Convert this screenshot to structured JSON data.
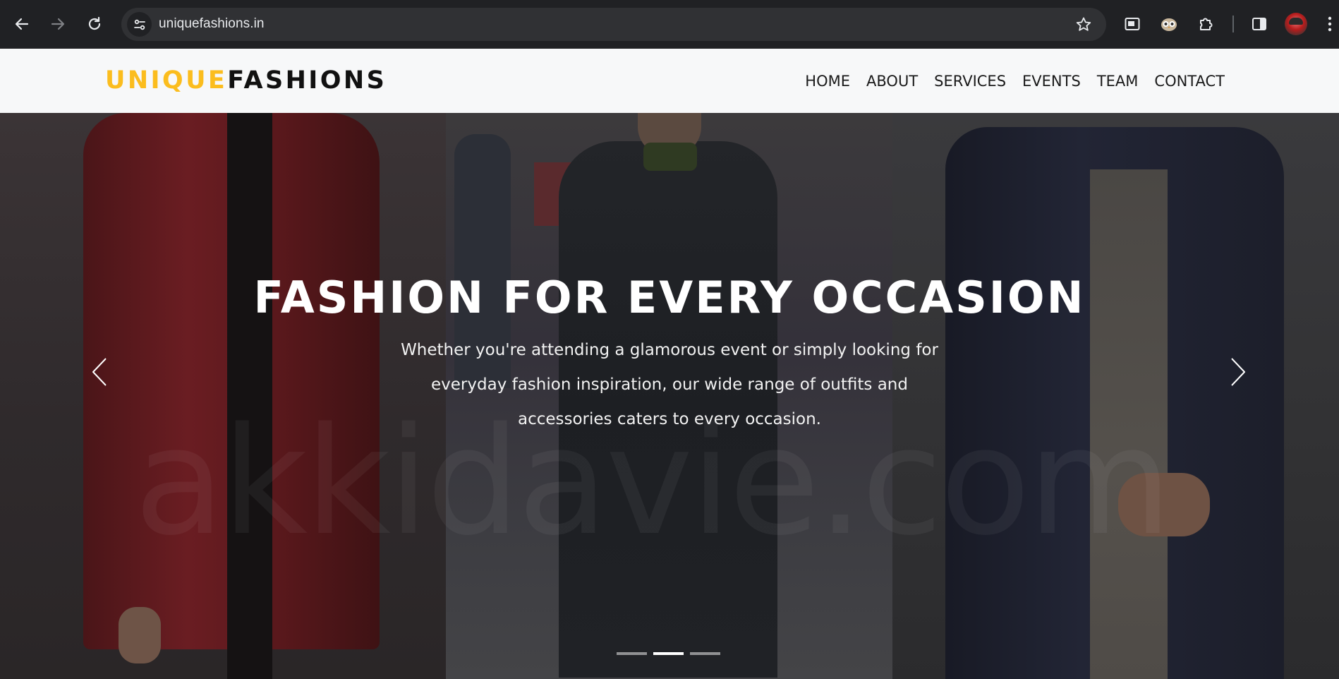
{
  "browser": {
    "url": "uniquefashions.in",
    "icons": [
      "back-icon",
      "forward-icon",
      "reload-icon",
      "site-info-icon",
      "star-icon",
      "picture-in-picture-icon",
      "extension-owl-icon",
      "extensions-puzzle-icon",
      "side-panel-icon",
      "profile-avatar",
      "more-menu-icon"
    ]
  },
  "site": {
    "logo_part1": "UNIQUE",
    "logo_part2": "FASHIONS",
    "nav": [
      "HOME",
      "ABOUT",
      "SERVICES",
      "EVENTS",
      "TEAM",
      "CONTACT"
    ],
    "accent_color": "#fbbd1e"
  },
  "hero": {
    "title": "FASHION FOR EVERY OCCASION",
    "text": "Whether you're attending a glamorous event or simply looking for everyday fashion inspiration, our wide range of outfits and accessories caters to every occasion.",
    "watermark": "akkidavie.com",
    "slide_count": 3,
    "active_slide": 2
  }
}
